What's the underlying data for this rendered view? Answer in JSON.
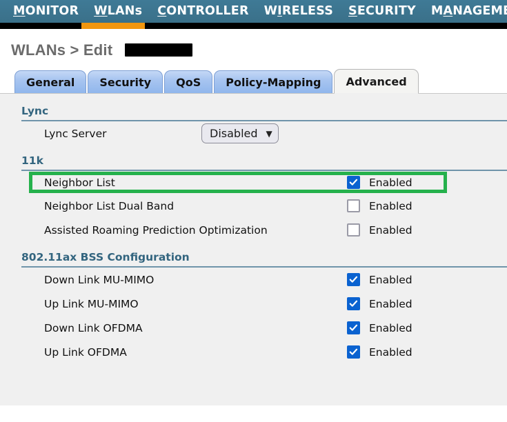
{
  "navbar": {
    "items": [
      {
        "label": "MONITOR",
        "accel": "M",
        "active": false
      },
      {
        "label": "WLANs",
        "accel": "W",
        "active": true
      },
      {
        "label": "CONTROLLER",
        "accel": "C",
        "active": false
      },
      {
        "label": "WIRELESS",
        "accel": "I",
        "active": false
      },
      {
        "label": "SECURITY",
        "accel": "S",
        "active": false
      },
      {
        "label": "MANAGEMENT",
        "accel": "A",
        "active": false
      }
    ],
    "active_indicator_color": "#f2960e",
    "background_color": "#3c7490"
  },
  "page": {
    "title": "WLANs > Edit",
    "redacted_value": ""
  },
  "tabs": [
    {
      "label": "General",
      "active": false
    },
    {
      "label": "Security",
      "active": false
    },
    {
      "label": "QoS",
      "active": false
    },
    {
      "label": "Policy-Mapping",
      "active": false
    },
    {
      "label": "Advanced",
      "active": true
    }
  ],
  "sections": [
    {
      "heading": "Lync",
      "rows": [
        {
          "label": "Lync Server",
          "control": "select",
          "value": "Disabled",
          "chevron": "chevron-down-icon"
        }
      ]
    },
    {
      "heading": "11k",
      "rows": [
        {
          "label": "Neighbor List",
          "control": "checkbox",
          "checked": true,
          "value": "Enabled",
          "highlighted": true
        },
        {
          "label": "Neighbor List Dual Band",
          "control": "checkbox",
          "checked": false,
          "value": "Enabled",
          "highlighted": false
        },
        {
          "label": "Assisted Roaming Prediction Optimization",
          "control": "checkbox",
          "checked": false,
          "value": "Enabled",
          "highlighted": false
        }
      ]
    },
    {
      "heading": "802.11ax BSS Configuration",
      "rows": [
        {
          "label": "Down Link MU-MIMO",
          "control": "checkbox",
          "checked": true,
          "value": "Enabled",
          "highlighted": false
        },
        {
          "label": "Up Link MU-MIMO",
          "control": "checkbox",
          "checked": true,
          "value": "Enabled",
          "highlighted": false
        },
        {
          "label": "Down Link OFDMA",
          "control": "checkbox",
          "checked": true,
          "value": "Enabled",
          "highlighted": false
        },
        {
          "label": "Up Link OFDMA",
          "control": "checkbox",
          "checked": true,
          "value": "Enabled",
          "highlighted": false
        }
      ]
    }
  ],
  "annotation": {
    "highlight_color": "#25b14c",
    "target_row": "Neighbor List"
  },
  "colors": {
    "nav_background": "#3c7490",
    "nav_active_underline": "#f2960e",
    "section_heading": "#33657f",
    "rule": "#6f94aa",
    "panel_background": "#f0f0f0",
    "checkbox_checked": "#0a62d0",
    "tab_inactive": "#a8c5f0",
    "tab_active": "#f4f4f2"
  }
}
